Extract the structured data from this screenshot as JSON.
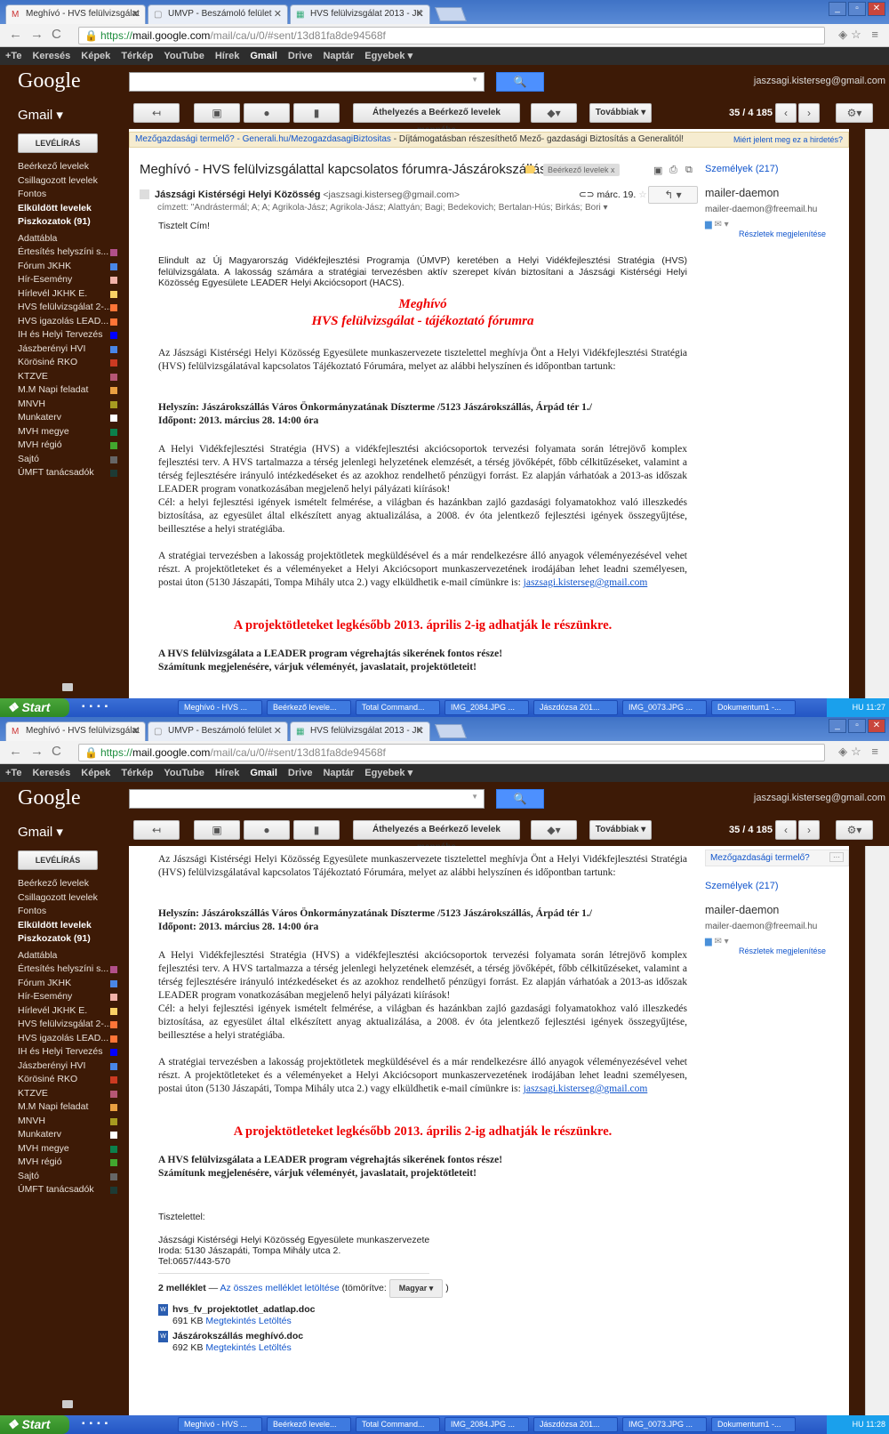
{
  "browser": {
    "tabs": [
      "Meghívó - HVS felülvizsgálat",
      "UMVP - Beszámoló felület",
      "HVS felülvizsgálat 2013 - JK"
    ],
    "url_scheme": "https://",
    "url_domain": "mail.google.com",
    "url_path": "/mail/ca/u/0/#sent/13d81fa8de94568f"
  },
  "gbar": {
    "items": [
      "+Te",
      "Keresés",
      "Képek",
      "Térkép",
      "YouTube",
      "Hírek",
      "Gmail",
      "Drive",
      "Naptár",
      "Egyebek ▾"
    ]
  },
  "header": {
    "logo": "Google",
    "search_button": "🔍",
    "user_email": "jaszsagi.kisterseg@gmail.com",
    "gmail_label": "Gmail ▾"
  },
  "toolbar": {
    "move_label": "Áthelyezés a Beérkező levelek mappába",
    "more_label": "Továbbiak ▾",
    "count": "35 / 4 185"
  },
  "sidebar": {
    "compose": "LEVÉLÍRÁS",
    "items": [
      {
        "label": "Beérkező levelek",
        "bold": false,
        "color": ""
      },
      {
        "label": "Csillagozott levelek",
        "bold": false,
        "color": ""
      },
      {
        "label": "Fontos",
        "bold": false,
        "color": ""
      },
      {
        "label": "Elküldött levelek",
        "bold": true,
        "color": ""
      },
      {
        "label": "Piszkozatok (91)",
        "bold": true,
        "color": ""
      },
      {
        "label": "Adattábla",
        "bold": false,
        "color": ""
      },
      {
        "label": "Értesítés helyszíni s...",
        "bold": false,
        "color": "#b2508a"
      },
      {
        "label": "Fórum JKHK",
        "bold": false,
        "color": "#4986e7"
      },
      {
        "label": "Hír-Esemény",
        "bold": false,
        "color": "#f2b2a8"
      },
      {
        "label": "Hírlevél JKHK E.",
        "bold": false,
        "color": "#fad165"
      },
      {
        "label": "HVS felülvizsgálat 2-...",
        "bold": false,
        "color": "#ff7537"
      },
      {
        "label": "HVS igazolás LEAD...",
        "bold": false,
        "color": "#ff7537"
      },
      {
        "label": "IH és Helyi Tervezés",
        "bold": false,
        "color": "#0000ff"
      },
      {
        "label": "Jászberényi HVI",
        "bold": false,
        "color": "#4986e7"
      },
      {
        "label": "Körösiné RKO",
        "bold": false,
        "color": "#cc3a21"
      },
      {
        "label": "KTZVE",
        "bold": false,
        "color": "#b65775"
      },
      {
        "label": "M.M Napi feladat",
        "bold": false,
        "color": "#eaa041"
      },
      {
        "label": "MNVH",
        "bold": false,
        "color": "#a79b20"
      },
      {
        "label": "Munkaterv",
        "bold": false,
        "color": "#ffffff"
      },
      {
        "label": "MVH megye",
        "bold": false,
        "color": "#0b804b"
      },
      {
        "label": "MVH régió",
        "bold": false,
        "color": "#42a62e"
      },
      {
        "label": "Sajtó",
        "bold": false,
        "color": "#666666"
      },
      {
        "label": "ÚMFT tanácsadók",
        "bold": false,
        "color": "#1d3a34"
      }
    ]
  },
  "ad": {
    "link": "Mezőgazdasági termelő? - Generali.hu/MezogazdasagiBiztositas",
    "text": " - Díjtámogatásban részesíthető Mező- gazdasági Biztosítás a Generalitól!",
    "why": "Miért jelent meg ez a hirdetés?",
    "short": "Mezőgazdasági termelő?",
    "short_more": "···"
  },
  "email": {
    "subject": "Meghívó - HVS felülvizsgálattal kapcsolatos fórumra-Jászárokszállás",
    "tag": "Beérkező levelek  x",
    "sender_name": "Jászsági Kistérségi Helyi Közösség",
    "sender_email": "<jaszsagi.kisterseg@gmail.com>",
    "date": "márc. 19.",
    "recipients": "címzett: \"Andrástermál; A; A; Agrikola-Jász; Agrikola-Jász; Alattyán; Bagi; Bedekovich; Bertalan-Hús; Birkás; Bori",
    "greeting": "Tisztelt Cím!",
    "intro": "Elindult az Új Magyarország Vidékfejlesztési Programja (ÚMVP) keretében a Helyi Vidékfejlesztési Stratégia (HVS) felülvizsgálata. A lakosság számára a stratégiai tervezésben aktív szerepet kíván biztosítani a Jászsági Kistérségi Helyi Közösség Egyesülete LEADER Helyi Akciócsoport (HACS).",
    "title_line1": "Meghívó",
    "title_line2": "HVS felülvizsgálat - tájékoztató fórumra",
    "invite": "Az Jászsági Kistérségi Helyi Közösség Egyesülete munkaszervezete tisztelettel meghívja Önt a Helyi Vidékfejlesztési Stratégia (HVS) felülvizsgálatával kapcsolatos Tájékoztató Fórumára, melyet az alábbi helyszínen és időpontban tartunk:",
    "location": "Helyszín: Jászárokszállás Város Önkormányzatának Díszterme /5123 Jászárokszállás, Árpád tér 1./",
    "time": "Időpont: 2013. március 28. 14:00 óra",
    "para1": "A Helyi Vidékfejlesztési Stratégia (HVS) a vidékfejlesztési akciócsoportok tervezési folyamata során létrejövő komplex fejlesztési terv. A HVS tartalmazza a térség jelenlegi helyzetének elemzését, a térség jövőképét, főbb célkitűzéseket, valamint a térség fejlesztésére irányuló intézkedéseket és az azokhoz rendelhető pénzügyi forrást. Ez alapján várhatóak a 2013-as időszak LEADER program vonatkozásában megjelenő helyi pályázati kiírások!",
    "para2": "Cél: a helyi fejlesztési igények ismételt felmérése, a világban és hazánkban zajló gazdasági folyamatokhoz való illeszkedés biztosítása, az egyesület által elkészített anyag aktualizálása, a 2008. év óta jelentkező fejlesztési igények összegyűjtése, beillesztése a helyi stratégiába.",
    "para3": "A stratégiai tervezésben a lakosság projektötletek megküldésével és a már rendelkezésre álló anyagok véleményezésével vehet részt. A projektötleteket és a véleményeket a Helyi Akciócsoport munkaszervezetének irodájában lehet leadni személyesen, postai úton (5130 Jászapáti, Tompa Mihály utca 2.) vagy elküldhetik e-mail címünkre is: ",
    "para3_link": "jaszsagi.kisterseg@gmail.com",
    "deadline": "A projektötleteket legkésőbb 2013. április 2-ig adhatják le részünkre.",
    "closing1": "A HVS felülvizsgálata a LEADER program végrehajtás sikerének fontos része!",
    "closing2": "Számítunk megjelenésére, várjuk véleményét, javaslatait, projektötleteit!",
    "regards": "Tisztelettel:",
    "sig1": "Jászsági Kistérségi Helyi Közösség Egyesülete munkaszervezete",
    "sig2": "Iroda: 5130 Jászapáti, Tompa Mihály utca 2.",
    "sig3": "Tel:0657/443-570"
  },
  "attachments": {
    "count_label": "2 melléklet",
    "dash": " — ",
    "download_all": "Az összes melléklet letöltése",
    "compressed": " (tömörítve:",
    "lang": "Magyar ▾",
    "close_paren": ")",
    "view": "Megtekintés",
    "download": "Letöltés",
    "files": [
      {
        "name": "hvs_fv_projektotlet_adatlap.doc",
        "size": "691 KB"
      },
      {
        "name": "Jászárokszállás meghívó.doc",
        "size": "692 KB"
      }
    ]
  },
  "right_pane": {
    "people": "Személyek (217)",
    "contact_name": "mailer-daemon",
    "contact_email": "mailer-daemon@freemail.hu",
    "details": "Részletek megjelenítése"
  },
  "taskbar": {
    "start": "Start",
    "items": [
      "Meghívó - HVS ...",
      "Beérkező levele...",
      "Total Command...",
      "IMG_2084.JPG ...",
      "Jászdózsa 201...",
      "IMG_0073.JPG ...",
      "Dokumentum1 -..."
    ],
    "lang": "HU",
    "clock1": "11:27",
    "clock2": "11:28"
  }
}
